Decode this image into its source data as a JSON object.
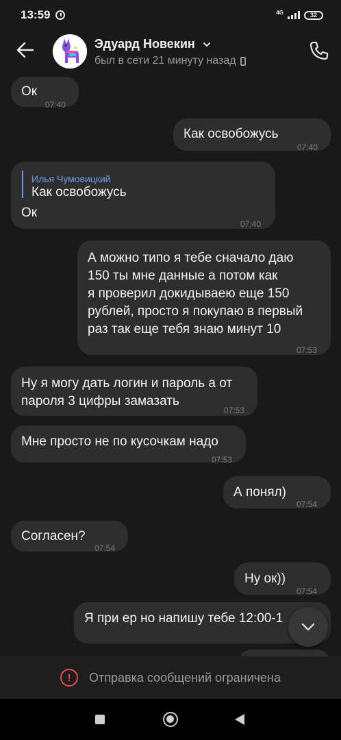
{
  "status_bar": {
    "time": "13:59",
    "network": "4G",
    "battery": "32"
  },
  "header": {
    "contact_name": "Эдуард Новекин",
    "last_seen": "был в сети 21 минуту назад"
  },
  "messages": [
    {
      "side": "in",
      "text": "Ок",
      "time": "07:40"
    },
    {
      "side": "out",
      "text": "Как освобожусь",
      "time": "07:40"
    },
    {
      "side": "in",
      "reply_author": "Илья Чумовицкий",
      "reply_text": "Как освобожусь",
      "text": "Ок",
      "time": "07:40"
    },
    {
      "side": "out",
      "lines": [
        "А можно типо я тебе сначало даю",
        "150 ты мне данные а потом как",
        "я проверил докидываею еще 150",
        "рублей, просто я покупаю в первый",
        "раз так еще тебя знаю минут 10"
      ],
      "time": "07:53"
    },
    {
      "side": "in",
      "lines": [
        "Ну я могу дать логин и пароль а от",
        "пароля 3 цифры замазать"
      ],
      "time": "07:53"
    },
    {
      "side": "in",
      "text": "Мне просто не по кусочкам надо",
      "time": "07:53"
    },
    {
      "side": "out",
      "text": "А понял)",
      "time": "07:54"
    },
    {
      "side": "in",
      "text": "Согласен?",
      "time": "07:54"
    },
    {
      "side": "out",
      "text": "Ну ок))",
      "time": "07:54"
    },
    {
      "side": "out",
      "text": "Я при ер но напишу тебе 12:00-1",
      "time": ""
    }
  ],
  "footer": {
    "restricted_text": "Отправка сообщений ограничена"
  },
  "colors": {
    "background": "#191919",
    "bubble": "#2e2e2e",
    "accent": "#6d9de3",
    "warning": "#e14b4b"
  }
}
